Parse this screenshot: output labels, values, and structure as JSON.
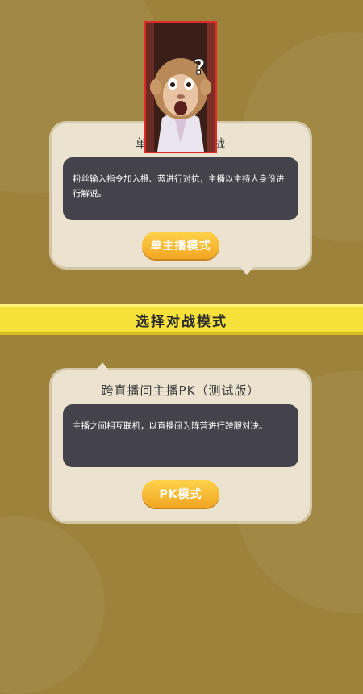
{
  "card_single": {
    "title": "单主播模式对战",
    "description": "粉丝输入指令加入橙、蓝进行对抗，主播以主持人身份进行解说。",
    "button_label": "单主播模式"
  },
  "banner": {
    "title": "选择对战模式"
  },
  "card_pk": {
    "title": "跨直播间主播PK（测试版）",
    "description": "主播之间相互联机，以直播间为阵营进行跨服对决。",
    "button_label": "PK模式"
  },
  "overlay": {
    "question_mark": "?"
  },
  "colors": {
    "background": "#9c823a",
    "card": "#ebe3cf",
    "desc_box": "#44434c",
    "button": "#f5b731",
    "banner": "#f5e13a",
    "pip_border": "#e02a2a"
  }
}
